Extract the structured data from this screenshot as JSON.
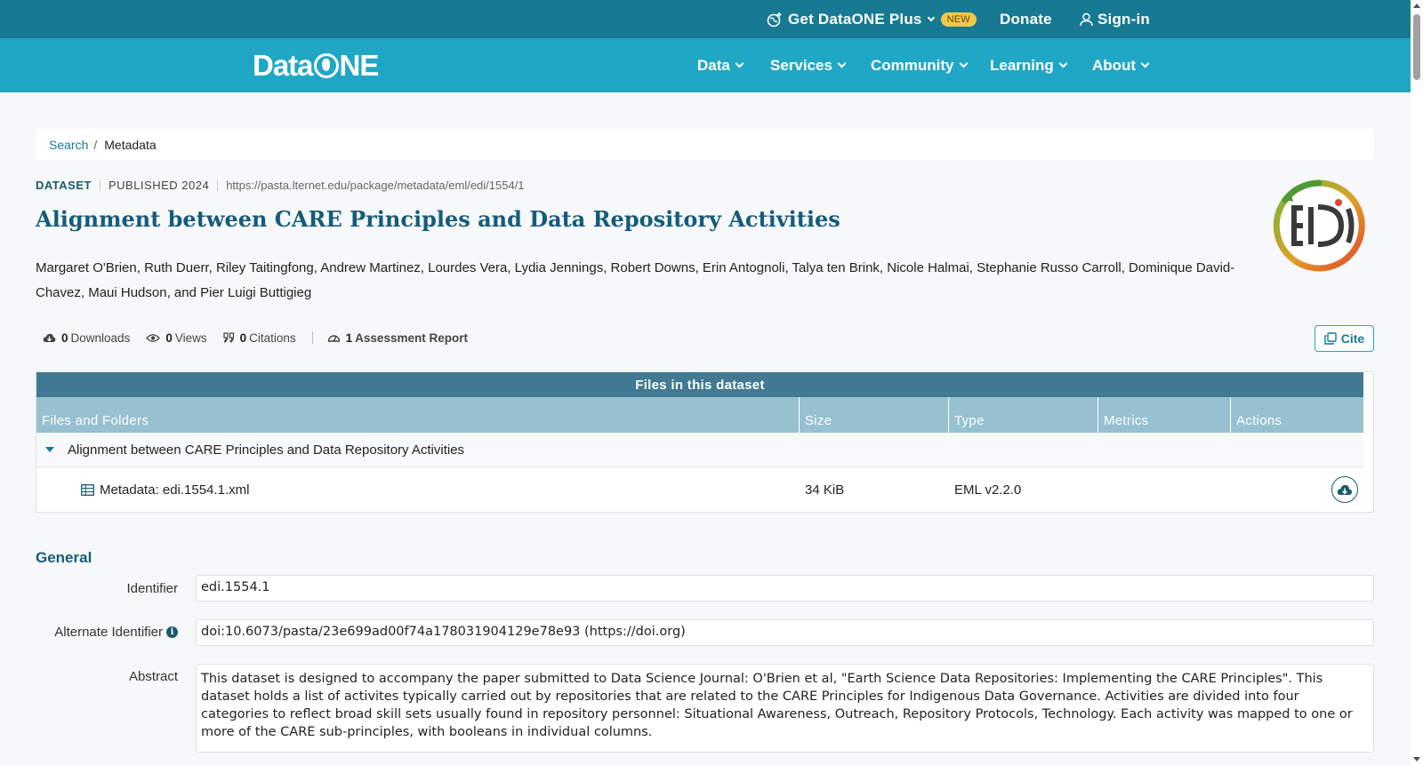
{
  "topbar": {
    "plus_label": "Get DataONE Plus",
    "new_badge": "NEW",
    "donate_label": "Donate",
    "signin_label": "Sign-in"
  },
  "navbar": {
    "logo_left": "Data",
    "logo_right": "NE",
    "items": [
      {
        "label": "Data"
      },
      {
        "label": "Services"
      },
      {
        "label": "Community"
      },
      {
        "label": "Learning"
      },
      {
        "label": "About"
      }
    ]
  },
  "breadcrumb": {
    "search_label": "Search",
    "separator": "/",
    "current": "Metadata"
  },
  "dataset": {
    "type_label": "DATASET",
    "published": "PUBLISHED 2024",
    "url": "https://pasta.lternet.edu/package/metadata/eml/edi/1554/1",
    "title": "Alignment between CARE Principles and Data Repository Activities",
    "authors": "Margaret O'Brien, Ruth Duerr, Riley Taitingfong, Andrew Martinez, Lourdes Vera, Lydia Jennings, Robert Downs, Erin Antognoli, Talya ten Brink, Nicole Halmai, Stephanie Russo Carroll, Dominique David-Chavez, Maui Hudson, and Pier Luigi Buttigieg",
    "repo_logo_icon": "edi-logo"
  },
  "metrics": {
    "downloads_count": "0",
    "downloads_label": "Downloads",
    "views_count": "0",
    "views_label": "Views",
    "citations_count": "0",
    "citations_label": "Citations",
    "assessment_count": "1",
    "assessment_label": "Assessment Report",
    "cite_label": "Cite"
  },
  "files": {
    "title": "Files in this dataset",
    "columns": [
      "Files and Folders",
      "Size",
      "Type",
      "Metrics",
      "Actions"
    ],
    "folder_name": "Alignment between CARE Principles and Data Repository Activities",
    "rows": [
      {
        "name": "Metadata: edi.1554.1.xml",
        "size": "34 KiB",
        "type": "EML v2.2.0",
        "metrics": "",
        "action_icon": "cloud-download-icon"
      }
    ]
  },
  "general": {
    "section_title": "General",
    "identifier_label": "Identifier",
    "identifier_value": "edi.1554.1",
    "alt_identifier_label": "Alternate Identifier",
    "alt_identifier_value": "doi:10.6073/pasta/23e699ad00f74a178031904129e78e93  (https://doi.org)",
    "abstract_label": "Abstract",
    "abstract_value": "This dataset is designed to accompany the paper submitted to Data Science Journal: O'Brien et al, \"Earth Science Data Repositories: Implementing the CARE Principles\". This dataset holds a list of activites typically carried out by repositories that are related to the CARE Principles for Indigenous Data Governance. Activities are divided into four categories to reflect broad skill sets usually found in repository personnel: Situational Awareness, Outreach, Repository Protocols, Technology. Each activity was mapped to one or more of the CARE sub-principles, with booleans in individual columns."
  },
  "colors": {
    "topbar": "#177a92",
    "navbar": "#21a7c6",
    "title": "#155c7a",
    "table_title": "#417a92",
    "table_head": "#97c1d1",
    "badge": "#f2c84b"
  }
}
